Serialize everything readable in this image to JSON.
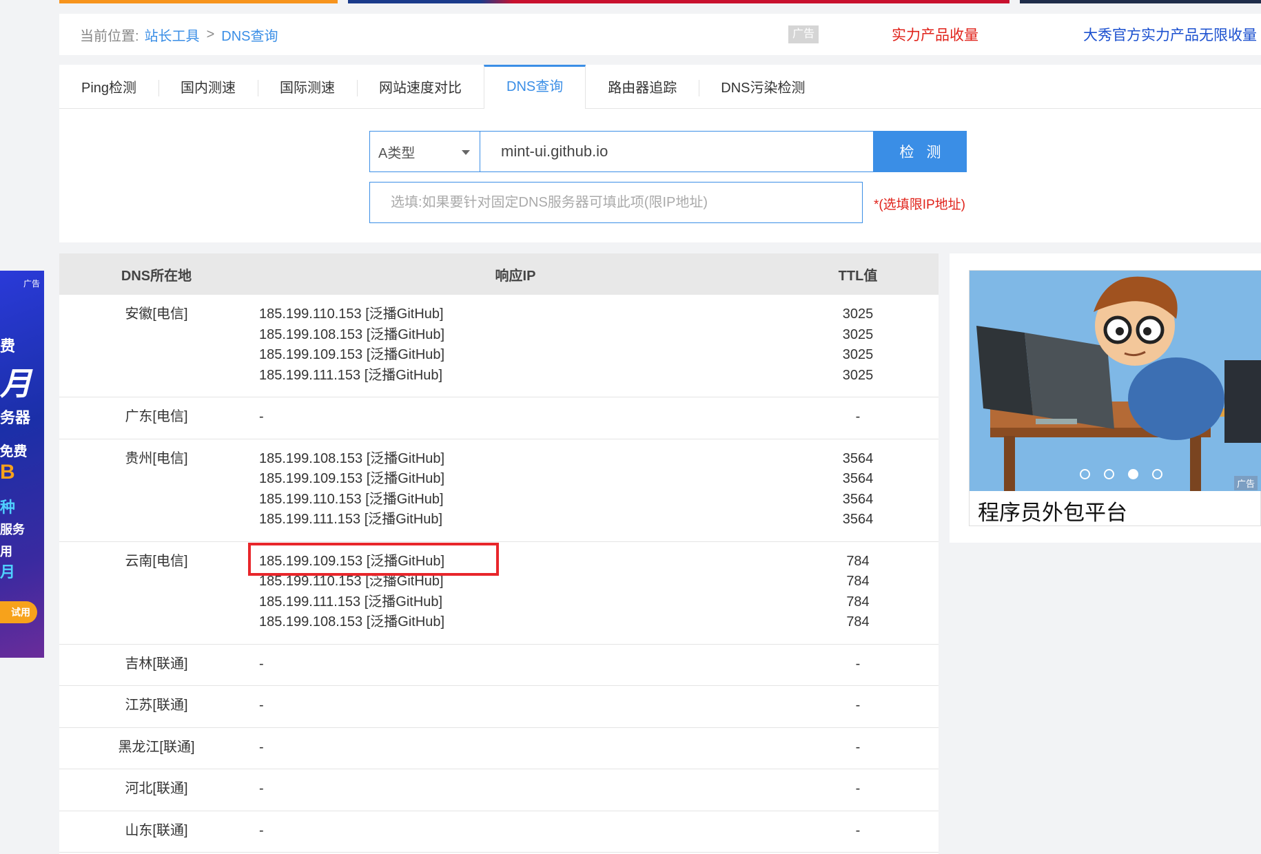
{
  "breadcrumb": {
    "label": "当前位置:",
    "items": [
      "站长工具",
      "DNS查询"
    ],
    "separator": ">"
  },
  "top_ads": {
    "badge": "广告",
    "link1": "实力产品收量",
    "link2": "大秀官方实力产品无限收量"
  },
  "tabs": [
    "Ping检测",
    "国内测速",
    "国际测速",
    "网站速度对比",
    "DNS查询",
    "路由器追踪",
    "DNS污染检测"
  ],
  "active_tab": "DNS查询",
  "form": {
    "record_type": "A类型",
    "domain": "mint-ui.github.io",
    "check_label": "检测",
    "dns_placeholder": "选填:如果要针对固定DNS服务器可填此项(限IP地址)",
    "dns_hint": "*(选填限IP地址)"
  },
  "table": {
    "headers": {
      "location": "DNS所在地",
      "ip": "响应IP",
      "ttl": "TTL值"
    },
    "rows": [
      {
        "location": "安徽[电信]",
        "ips": [
          "185.199.110.153 [泛播GitHub]",
          "185.199.108.153 [泛播GitHub]",
          "185.199.109.153 [泛播GitHub]",
          "185.199.111.153 [泛播GitHub]"
        ],
        "ttls": [
          "3025",
          "3025",
          "3025",
          "3025"
        ]
      },
      {
        "location": "广东[电信]",
        "ips": [
          "-"
        ],
        "ttls": [
          "-"
        ]
      },
      {
        "location": "贵州[电信]",
        "ips": [
          "185.199.108.153 [泛播GitHub]",
          "185.199.109.153 [泛播GitHub]",
          "185.199.110.153 [泛播GitHub]",
          "185.199.111.153 [泛播GitHub]"
        ],
        "ttls": [
          "3564",
          "3564",
          "3564",
          "3564"
        ]
      },
      {
        "location": "云南[电信]",
        "ips": [
          "185.199.109.153 [泛播GitHub]",
          "185.199.110.153 [泛播GitHub]",
          "185.199.111.153 [泛播GitHub]",
          "185.199.108.153 [泛播GitHub]"
        ],
        "ttls": [
          "784",
          "784",
          "784",
          "784"
        ]
      },
      {
        "location": "吉林[联通]",
        "ips": [
          "-"
        ],
        "ttls": [
          "-"
        ]
      },
      {
        "location": "江苏[联通]",
        "ips": [
          "-"
        ],
        "ttls": [
          "-"
        ]
      },
      {
        "location": "黑龙江[联通]",
        "ips": [
          "-"
        ],
        "ttls": [
          "-"
        ]
      },
      {
        "location": "河北[联通]",
        "ips": [
          "-"
        ],
        "ttls": [
          "-"
        ]
      },
      {
        "location": "山东[联通]",
        "ips": [
          "-"
        ],
        "ttls": [
          "-"
        ]
      }
    ]
  },
  "side_ad": {
    "caption": "程序员外包平台",
    "corner": "广告",
    "active_slide": 3,
    "slide_count": 4
  },
  "left_ad": {
    "tag": "广告",
    "lines": [
      "费",
      "月",
      "务器",
      ".免费",
      "B",
      "种",
      "服务",
      "用",
      "月"
    ],
    "button": "试用"
  },
  "colors": {
    "accent": "#3a8ee6",
    "highlight": "#e8262b",
    "ad_red": "#e0221a",
    "ad_blue": "#1a4fcf"
  }
}
